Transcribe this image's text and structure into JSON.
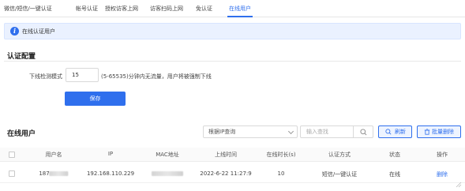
{
  "tabs": [
    {
      "label": "微信/短信/一键认证",
      "active": false
    },
    {
      "label": "帐号认证",
      "active": false
    },
    {
      "label": "授权访客上网",
      "active": false
    },
    {
      "label": "访客扫码上网",
      "active": false
    },
    {
      "label": "免认证",
      "active": false
    },
    {
      "label": "在线用户",
      "active": true
    }
  ],
  "info": {
    "text": "在线认证用户",
    "icon": "info-icon"
  },
  "auth_config": {
    "title": "认证配置",
    "offline_mode_label": "下线检测模式",
    "offline_mode_value": "15",
    "hint": "(5-65535)分钟内无流量，用户将被强制下线",
    "save_label": "保存"
  },
  "online_users": {
    "title": "在线用户",
    "query_select": "根据IP查询",
    "search_placeholder": "输入查找",
    "refresh_label": "刷新",
    "batch_delete_label": "批量删除",
    "columns": [
      "用户名",
      "IP",
      "MAC地址",
      "上线时间",
      "在线时长(s)",
      "认证方式",
      "状态",
      "操作"
    ],
    "rows": [
      {
        "username_prefix": "187",
        "ip": "192.168.110.229",
        "online_time": "2022-6-22 11:27:9",
        "duration": "10",
        "auth_method": "短信/一键认证",
        "status": "在线",
        "action": "删除"
      }
    ]
  },
  "colors": {
    "accent": "#2f6fed",
    "info_bg": "#eaf1ff"
  }
}
